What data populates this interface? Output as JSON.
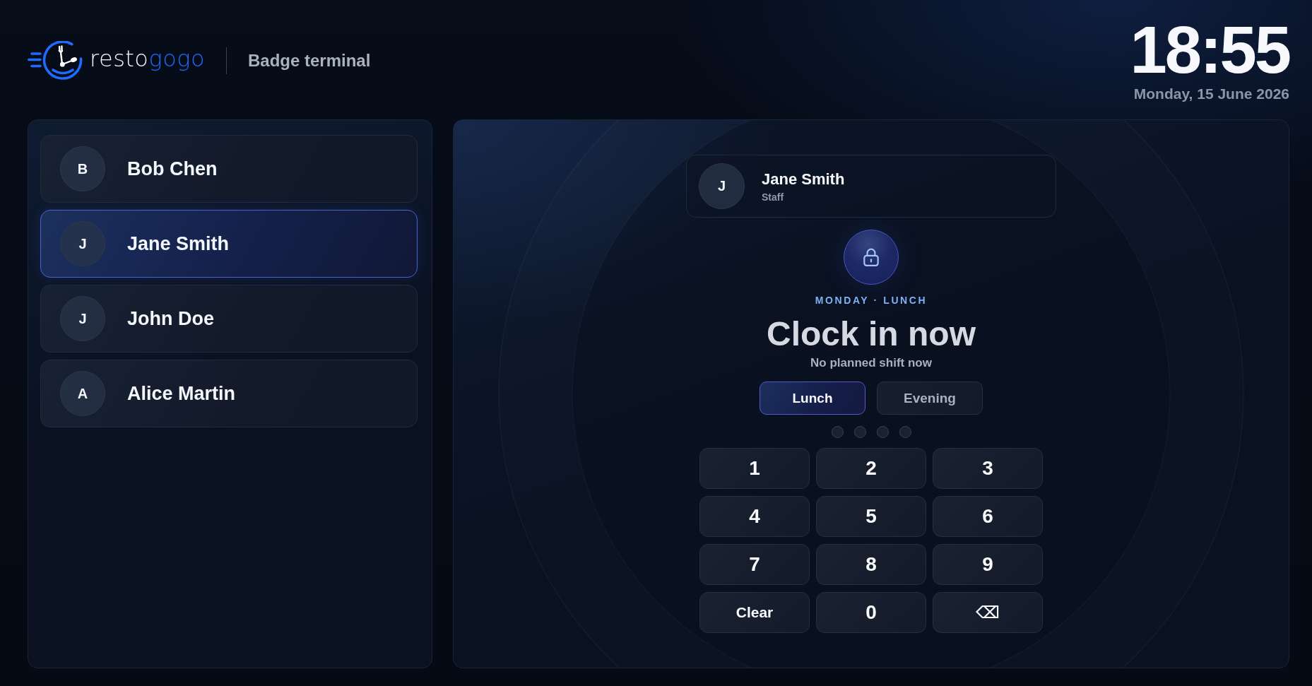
{
  "header": {
    "brand": [
      {
        "text": "resto",
        "accent": false
      },
      {
        "text": "gogo",
        "accent": true
      }
    ],
    "title": "Badge terminal",
    "clock": {
      "time": "18:55",
      "date": "Monday, 15 June 2026"
    }
  },
  "staff_list": [
    {
      "initial": "B",
      "name": "Bob Chen",
      "selected": false
    },
    {
      "initial": "J",
      "name": "Jane Smith",
      "selected": true
    },
    {
      "initial": "J",
      "name": "John Doe",
      "selected": false
    },
    {
      "initial": "A",
      "name": "Alice Martin",
      "selected": false
    }
  ],
  "badge_panel": {
    "user": {
      "initial": "J",
      "name": "Jane Smith",
      "role": "Staff"
    },
    "context": "MONDAY · LUNCH",
    "heading": "Clock in now",
    "subtitle": "No planned shift now",
    "shifts": [
      {
        "label": "Lunch",
        "selected": true
      },
      {
        "label": "Evening",
        "selected": false
      }
    ],
    "pin_dots": [
      {
        "filled": false
      },
      {
        "filled": false
      },
      {
        "filled": false
      },
      {
        "filled": false
      }
    ],
    "keypad": [
      {
        "label": "1",
        "kind": "digit"
      },
      {
        "label": "2",
        "kind": "digit"
      },
      {
        "label": "3",
        "kind": "digit"
      },
      {
        "label": "4",
        "kind": "digit"
      },
      {
        "label": "5",
        "kind": "digit"
      },
      {
        "label": "6",
        "kind": "digit"
      },
      {
        "label": "7",
        "kind": "digit"
      },
      {
        "label": "8",
        "kind": "digit"
      },
      {
        "label": "9",
        "kind": "digit"
      },
      {
        "label": "Clear",
        "kind": "clear"
      },
      {
        "label": "0",
        "kind": "digit"
      },
      {
        "label": "⌫",
        "kind": "backspace"
      }
    ]
  }
}
